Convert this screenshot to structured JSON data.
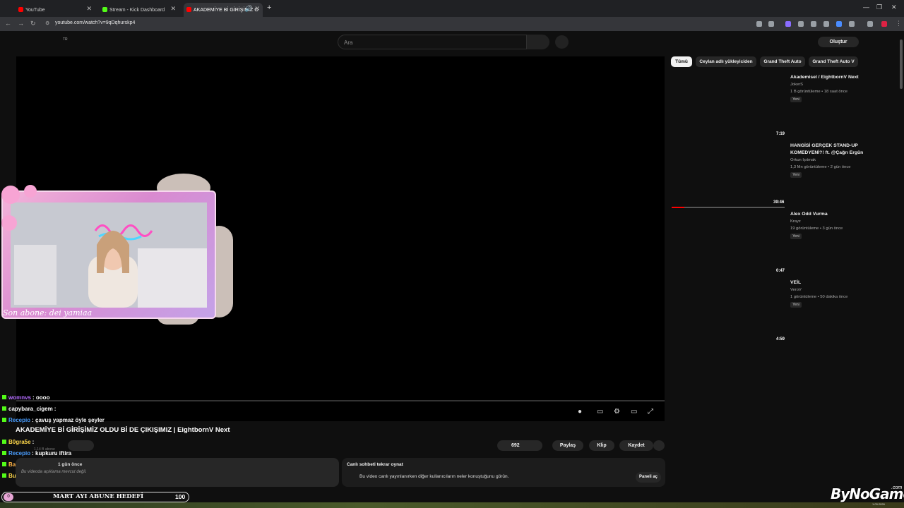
{
  "browser": {
    "tabs": [
      {
        "title": "YouTube",
        "favicon_color": "#ff0000"
      },
      {
        "title": "Stream - Kick Dashboard",
        "favicon_color": "#53fc18"
      },
      {
        "title": "AKADEMİYE Bİ GİRİŞİMİZ O",
        "favicon_color": "#ff0000"
      }
    ],
    "new_tab_icon": "plus-icon",
    "url": "youtube.com/watch?v=9qDqhurskp4"
  },
  "header": {
    "country_code": "TR",
    "search_placeholder": "Ara",
    "create_label": "Oluştur"
  },
  "player": {
    "controls": [
      "autoplay-icon",
      "subtitles-icon",
      "settings-icon",
      "theater-icon",
      "fullscreen-icon"
    ]
  },
  "webcam": {
    "label": "Son abone: dei yamiaa"
  },
  "chat": [
    {
      "user": "womnvs",
      "message": ": oooo",
      "user_color": "#b46cff"
    },
    {
      "user": "capybara_cigem",
      "message": ":",
      "user_color": "#ffffff"
    },
    {
      "user": "Recepio",
      "message": ": çavuş yapmaz öyle şeyler",
      "user_color": "#4a9eff"
    },
    {
      "user": "",
      "message": "AKADEMİYE Bİ GİRİŞİMİZ OLDU Bİ DE ÇIKIŞIMIZ | EightbornV Next",
      "user_color": "#ffffff"
    },
    {
      "user": "B0gra5e",
      "message": ":",
      "user_color": "#ffd84a"
    },
    {
      "user": "Recepio",
      "message": ": kupkuru iftira",
      "user_color": "#4a9eff"
    },
    {
      "user": "BarisCan360",
      "message": "",
      "user_color": "#ffb347"
    },
    {
      "user": "BugraSe",
      "message": ":",
      "user_color": "#ffd84a"
    }
  ],
  "video": {
    "title": "AKADEMİYE Bİ GİRİŞİMİZ OLDU Bİ DE ÇIKIŞIMIZ | EightbornV Next",
    "subscribers": "1,14 B abone",
    "likes": "692",
    "share_label": "Paylaş",
    "clip_label": "Klip",
    "save_label": "Kaydet",
    "date": "1 gün önce",
    "description": "Bu videoda açıklama mevcut değil."
  },
  "chat_replay": {
    "title": "Canlı sohbeti tekrar oynat",
    "text": "Bu video canlı yayınlanırken diğer kullanıcıların neler konuştuğunu görün.",
    "button_label": "Paneli aç"
  },
  "sidebar": {
    "chips": [
      "Tümü",
      "Ceylan adlı yükleyiciden",
      "Grand Theft Auto",
      "Grand Theft Auto V"
    ],
    "videos": [
      {
        "title": "Akademisel / EightbornV Next",
        "channel": "JokerS",
        "meta": "1 B görüntüleme • 18 saat önce",
        "badge": "Yeni",
        "duration": "7:19"
      },
      {
        "title": "HANGİSİ GERÇEK STAND-UP KOMEDYENİ?! ft. @Çağrı Ergün",
        "channel": "Orkun Işıtmak",
        "meta": "1,3 Mn görüntüleme • 2 gün önce",
        "badge": "Yeni",
        "duration": "39:46"
      },
      {
        "title": "Alex Odd Vurma",
        "channel": "Krayz",
        "meta": "19 görüntüleme • 3 gün önce",
        "badge": "Yeni",
        "duration": "0:47"
      },
      {
        "title": "VEİL",
        "channel": "VeroV",
        "meta": "1 görüntüleme • 50 dakika önce",
        "badge": "Yeni",
        "duration": "4:59"
      }
    ]
  },
  "goal": {
    "label": "MART AYI ABUNE HEDEFİ",
    "value": "100",
    "circle": "0"
  },
  "watermark": {
    "text": "ByNoGame",
    "suffix": ".com",
    "date": "1.03.2026"
  }
}
